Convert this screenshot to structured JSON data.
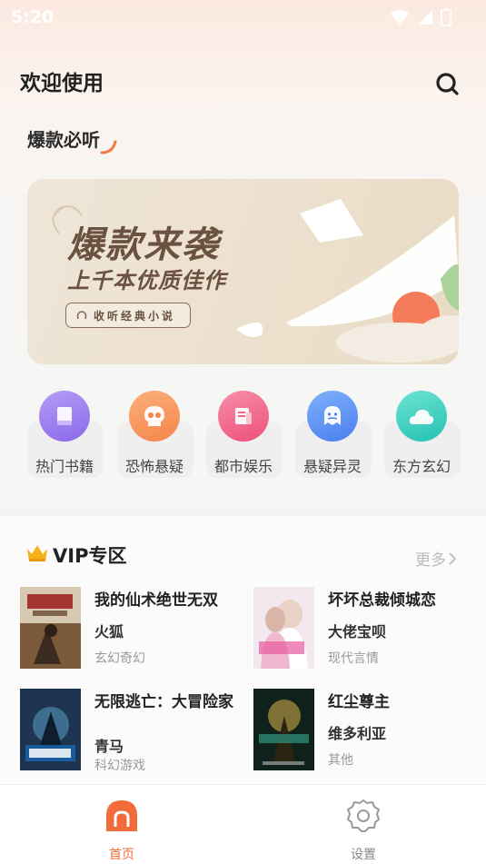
{
  "status_bar": {
    "time": "5:20"
  },
  "header": {
    "title": "欢迎使用",
    "search_icon": "search-icon"
  },
  "hot_section": {
    "title": "爆款必听"
  },
  "banner": {
    "title": "爆款来袭",
    "subtitle": "上千本优质佳作",
    "button_label": "收听经典小说"
  },
  "categories": [
    {
      "label": "热门书籍",
      "icon": "book-icon",
      "color": "#9d7cf0"
    },
    {
      "label": "恐怖悬疑",
      "icon": "skull-icon",
      "color": "#f89a5e"
    },
    {
      "label": "都市娱乐",
      "icon": "document-icon",
      "color": "#f2668c"
    },
    {
      "label": "悬疑异灵",
      "icon": "ghost-icon",
      "color": "#5a8ef5"
    },
    {
      "label": "东方玄幻",
      "icon": "cloud-icon",
      "color": "#39cfc0"
    }
  ],
  "vip": {
    "title": "VIP专区",
    "more_label": "更多",
    "books": [
      {
        "title": "我的仙术绝世无双",
        "author": "火狐",
        "genre": "玄幻奇幻"
      },
      {
        "title": "坏坏总裁倾城恋",
        "author": "大佬宝呗",
        "genre": "现代言情"
      },
      {
        "title": "无限逃亡：大冒险家",
        "author": "青马",
        "genre": "科幻游戏"
      },
      {
        "title": "红尘尊主",
        "author": "维多利亚",
        "genre": "其他"
      }
    ]
  },
  "bottom_nav": {
    "items": [
      {
        "label": "首页",
        "active": true
      },
      {
        "label": "设置",
        "active": false
      }
    ],
    "active_color": "#f26b3a",
    "inactive_color": "#888888"
  }
}
